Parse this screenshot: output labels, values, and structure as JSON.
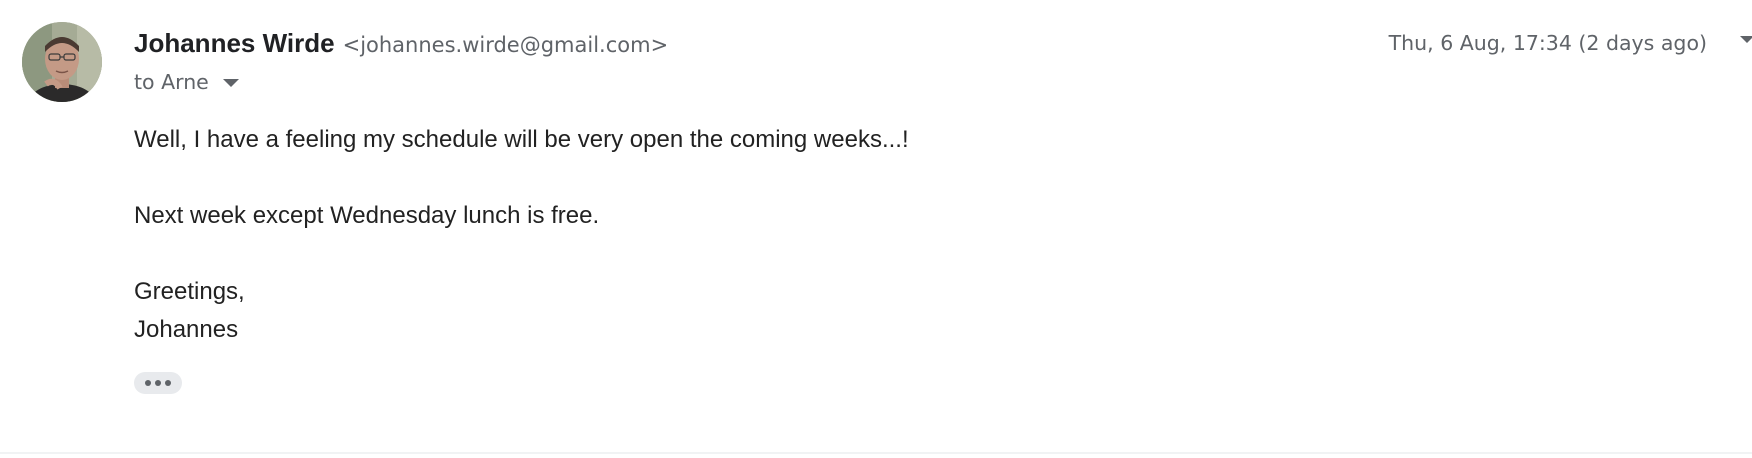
{
  "sender": {
    "name": "Johannes Wirde",
    "email": "<johannes.wirde@gmail.com>"
  },
  "timestamp": "Thu, 6 Aug, 17:34 (2 days ago)",
  "recipient": {
    "text": "to Arne"
  },
  "body": {
    "line1": "Well, I have a feeling my schedule will be very open the coming weeks...!",
    "line2": "Next week except Wednesday lunch is free.",
    "line3": "Greetings,",
    "line4": "Johannes"
  },
  "icons": {
    "avatar": "user-photo",
    "recipient_details": "caret-down-icon",
    "show_trimmed": "more-horiz-icon",
    "right_edge": "caret-down-icon"
  },
  "colors": {
    "name": "#202124",
    "secondary_text": "#5f6368",
    "body_text": "#222222",
    "chip_bg": "#e8eaed"
  }
}
